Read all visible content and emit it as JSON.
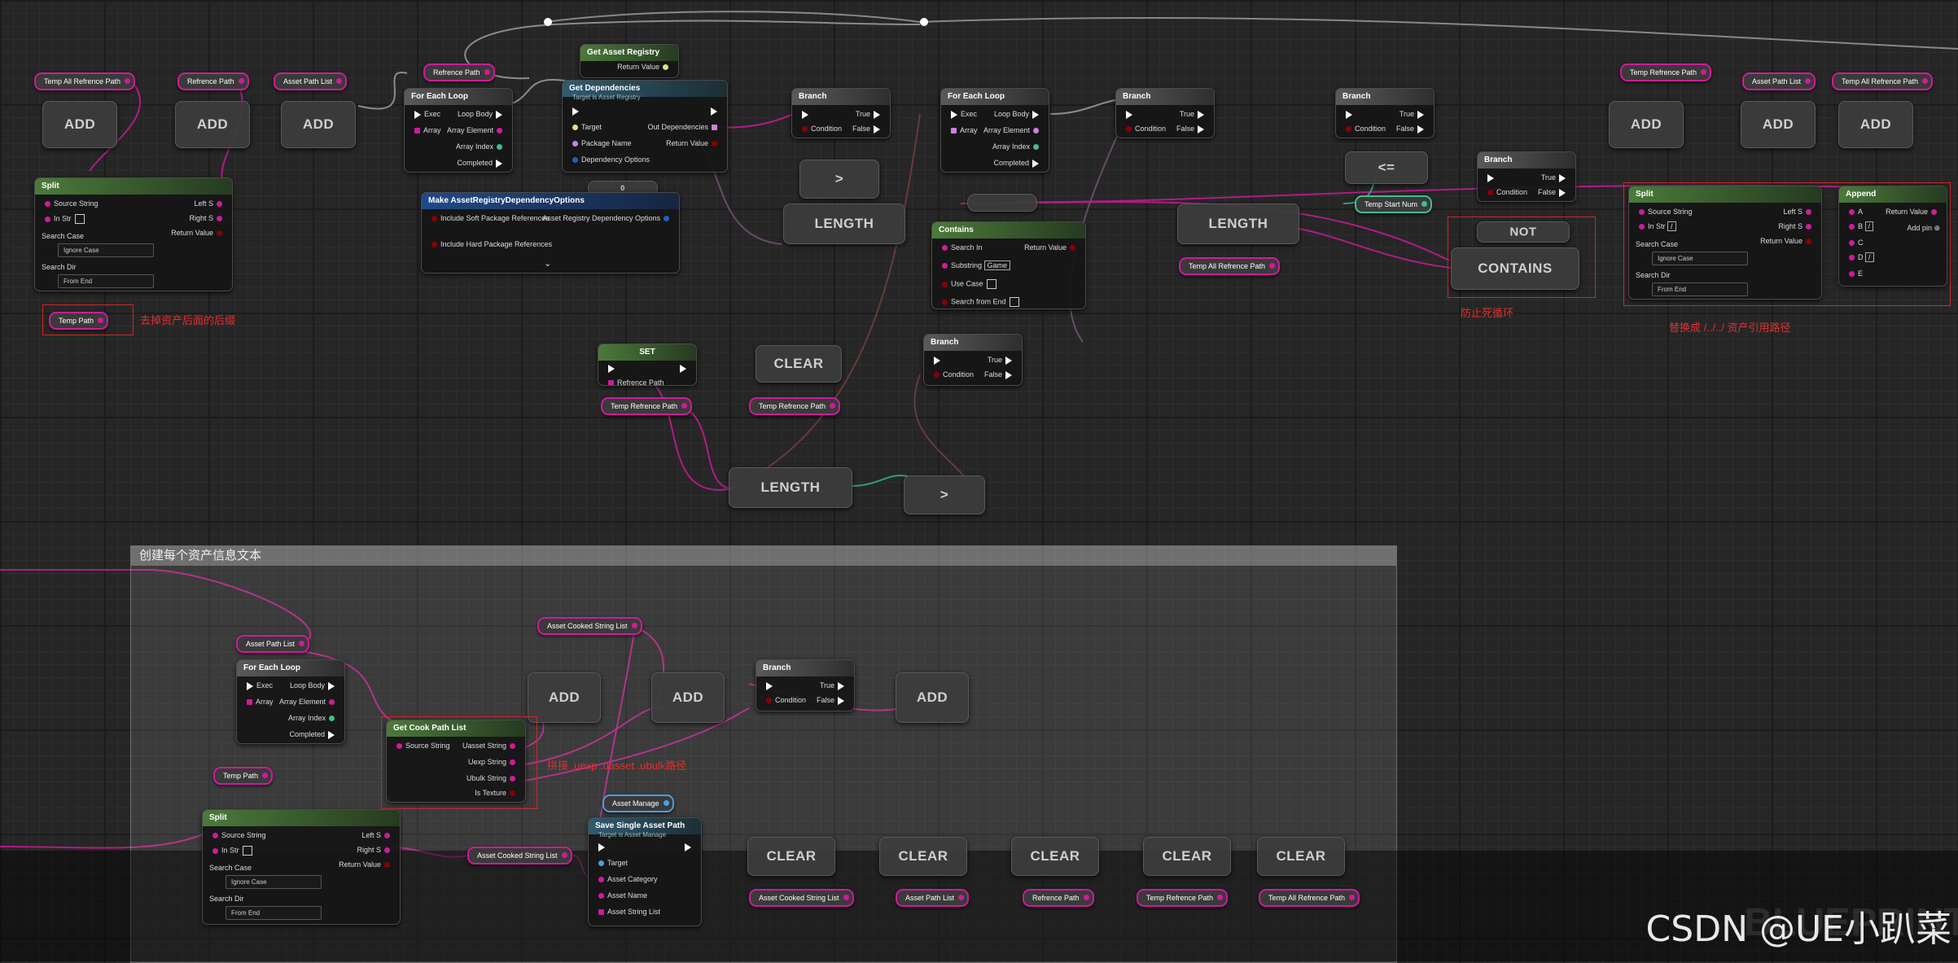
{
  "comment": {
    "title": "创建每个资产信息文本"
  },
  "annotations": [
    "去掉资产后面的后缀",
    "防止死循环",
    "替换成 /../../ 资产引用路径",
    "拼接 .uexp .uasset .ubulk路径"
  ],
  "watermark": {
    "csdn": "CSDN @UE小趴菜",
    "blueprint": "BLUEPRINT"
  },
  "variables": {
    "temp_all_refrence_path": "Temp All Refrence Path",
    "refrence_path": "Refrence Path",
    "asset_path_list": "Asset Path List",
    "temp_path": "Temp Path",
    "temp_refrence_path": "Temp Refrence Path",
    "temp_start_num": "Temp Start Num",
    "asset_cooked_string_list": "Asset Cooked String List",
    "asset_manage": "Asset Manage"
  },
  "labels": {
    "add": "ADD",
    "length": "LENGTH",
    "clear": "CLEAR",
    "not": "NOT",
    "contains_big": "CONTAINS",
    "set": "SET",
    "lte": "<=",
    "gt": ">"
  },
  "nodes": {
    "split": {
      "title": "Split",
      "source_string": "Source String",
      "in_str": "In Str",
      "search_case": "Search Case",
      "ignore_case": "Ignore Case",
      "search_dir": "Search Dir",
      "from_end": "From End",
      "left_s": "Left S",
      "right_s": "Right S",
      "return_value": "Return Value"
    },
    "for_each_loop": {
      "title": "For Each Loop",
      "exec": "Exec",
      "array": "Array",
      "loop_body": "Loop Body",
      "array_element": "Array Element",
      "array_index": "Array Index",
      "completed": "Completed"
    },
    "get_asset_registry": {
      "title": "Get Asset Registry",
      "return_value": "Return Value"
    },
    "get_dependencies": {
      "title": "Get Dependencies",
      "subtitle": "Target is Asset Registry",
      "target": "Target",
      "package_name": "Package Name",
      "dependency_options": "Dependency Options",
      "out_dependencies": "Out Dependencies",
      "return_value": "Return Value"
    },
    "make_options": {
      "title": "Make AssetRegistryDependencyOptions",
      "include_soft": "Include Soft Package References",
      "include_hard": "Include Hard Package References",
      "out": "Asset Registry Dependency Options"
    },
    "branch": {
      "title": "Branch",
      "condition": "Condition",
      "true": "True",
      "false": "False"
    },
    "contains": {
      "title": "Contains",
      "search_in": "Search In",
      "substring": "Substring",
      "substring_value": "Game",
      "use_case": "Use Case",
      "search_from_end": "Search from End",
      "return_value": "Return Value"
    },
    "append": {
      "title": "Append",
      "a": "A",
      "b": "B",
      "b_value": "/",
      "c": "C",
      "d": "D",
      "d_value": "/",
      "e": "E",
      "add_pin": "Add pin",
      "return_value": "Return Value"
    },
    "split2": {
      "in_str_value": "/"
    },
    "get_cook_path_list": {
      "title": "Get Cook Path List",
      "source_string": "Source String",
      "uasset": "Uasset String",
      "uexp": "Uexp String",
      "ubulk": "Ubulk String",
      "is_texture": "Is Texture"
    },
    "save_single": {
      "title": "Save Single Asset Path",
      "subtitle": "Target is Asset Manage",
      "target": "Target",
      "asset_category": "Asset Category",
      "asset_name": "Asset Name",
      "asset_string_list": "Asset String List"
    },
    "int_literal": {
      "zero": "0"
    }
  }
}
